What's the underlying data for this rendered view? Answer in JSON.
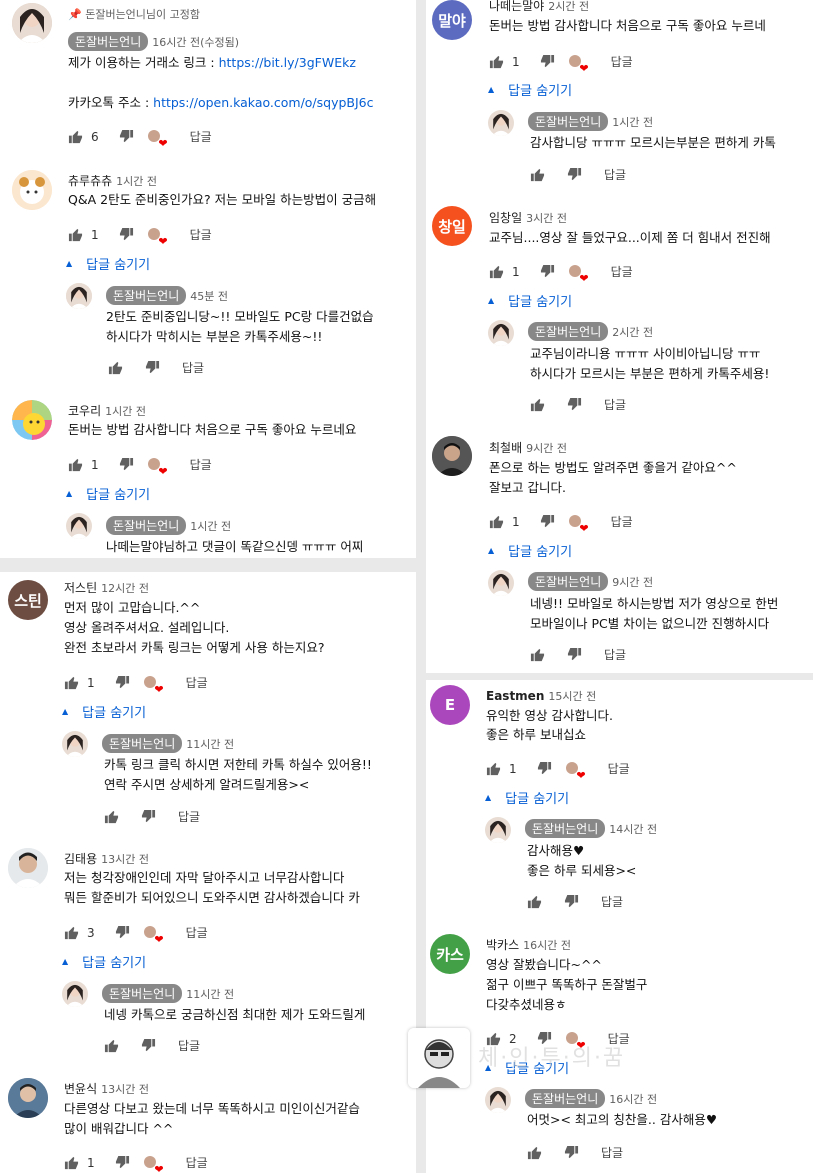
{
  "owner": "돈잘버는언니",
  "reply_label": "답글",
  "hide_replies_label": "답글 숨기기",
  "pinned_label": "돈잘버는언니님이 고정함",
  "left": {
    "c1": {
      "time": "16시간 전(수정됨)",
      "line1": "제가 이용하는 거래소 링크 : ",
      "link1": "https://bit.ly/3gFWEkz",
      "line2": "카카오톡 주소 : ",
      "link2": "https://open.kakao.com/o/sqypBJ6c",
      "likes": "6"
    },
    "c2": {
      "name": "츄루츄츄",
      "time": "1시간 전",
      "text": "Q&A 2탄도 준비중인가요? 저는 모바일 하는방법이 궁금해",
      "likes": "1",
      "reply": {
        "time": "45분 전",
        "line1": "2탄도 준비중입니당~!! 모바일도 PC랑 다를건없습",
        "line2": "하시다가 막히시는 부분은 카톡주세용~!!"
      }
    },
    "c3": {
      "name": "코우리",
      "time": "1시간 전",
      "text": "돈버는 방법 감사합니다 처음으로 구독 좋아요 누르네요",
      "likes": "1",
      "reply": {
        "time": "1시간 전",
        "line1": "나떼는말야님하고 댓글이 똑같으신뎅 ㅠㅠㅠ 어찌"
      }
    },
    "c4": {
      "avatar": "스틴",
      "name": "저스틴",
      "time": "12시간 전",
      "line1": "먼저 많이 고맙습니다.^^",
      "line2": "영상 올려주셔서요. 설레입니다.",
      "line3": "완전 초보라서 카톡 링크는 어떻게 사용 하는지요?",
      "likes": "1",
      "reply": {
        "time": "11시간 전",
        "line1": "카톡 링크 클릭 하시면 저한테 카톡 하실수 있어용!!",
        "line2": "연락 주시면 상세하게 알려드릴게용><"
      }
    },
    "c5": {
      "name": "김태용",
      "time": "13시간 전",
      "line1": "저는 청각장애인인데 자막 달아주시고 너무감사합니다",
      "line2": "뭐든 할준비가 되어있으니 도와주시면 감사하겠습니다 카",
      "likes": "3",
      "reply": {
        "time": "11시간 전",
        "line1": "네넹 카톡으로 궁금하신점 최대한 제가 도와드릴게"
      }
    },
    "c6": {
      "name": "변윤식",
      "time": "13시간 전",
      "line1": "다른영상 다보고 왔는데 너무 똑똑하시고 미인이신거같습",
      "line2": "많이 배워갑니다 ^^",
      "likes": "1"
    }
  },
  "right": {
    "c1": {
      "avatar": "말야",
      "name": "나떼는말야",
      "time": "2시간 전",
      "text": "돈버는 방법 감사합니다 처음으로 구독 좋아요 누르네",
      "likes": "1",
      "reply": {
        "time": "1시간 전",
        "line1": "감사합니당 ㅠㅠㅠ 모르시는부분은 편하게 카톡"
      }
    },
    "c2": {
      "avatar": "창일",
      "name": "임창일",
      "time": "3시간 전",
      "text": "교주님....영상 잘 들었구요...이제 쫌 더 힘내서 전진해",
      "likes": "1",
      "reply": {
        "time": "2시간 전",
        "line1": "교주님이라니용 ㅠㅠㅠ 사이비아닙니당 ㅠㅠ",
        "line2": "하시다가 모르시는 부분은 편하게 카톡주세용!"
      }
    },
    "c3": {
      "name": "최철배",
      "time": "9시간 전",
      "line1": "폰으로 하는 방법도 알려주면 좋을거 같아요^^",
      "line2": "잘보고 갑니다.",
      "likes": "1",
      "reply": {
        "time": "9시간 전",
        "line1": "네넹!! 모바일로 하시는방법 저가 영상으로 한번",
        "line2": "모바일이나 PC별 차이는 없으니깐 진행하시다"
      }
    },
    "c4": {
      "avatar": "E",
      "name": "Eastmen",
      "time": "15시간 전",
      "line1": "유익한 영상 감사합니다.",
      "line2": "좋은 하루 보내십쇼",
      "likes": "1",
      "reply": {
        "time": "14시간 전",
        "line1": "감사해용♥",
        "line2": "좋은 하루 되세용><"
      }
    },
    "c5": {
      "avatar": "카스",
      "name": "박카스",
      "time": "16시간 전",
      "line1": "영상 잘봤습니다~^^",
      "line2": "젊구 이쁘구 똑똑하구 돈잘벌구",
      "line3": "다갖추셨네용ㅎ",
      "likes": "2",
      "reply": {
        "time": "16시간 전",
        "line1": "어멋>< 최고의 칭찬을.. 감사해용♥"
      }
    }
  },
  "watermark": "체·인·투·의·꿈",
  "colors": {
    "link": "#065fd4",
    "owner_badge": "#888888",
    "heart": "#e00000",
    "avatar_malya": "#5c6bc0",
    "avatar_changil": "#f4511e",
    "avatar_justin": "#6d4c41",
    "avatar_eastmen": "#ab47bc",
    "avatar_bacchus": "#43a047"
  }
}
